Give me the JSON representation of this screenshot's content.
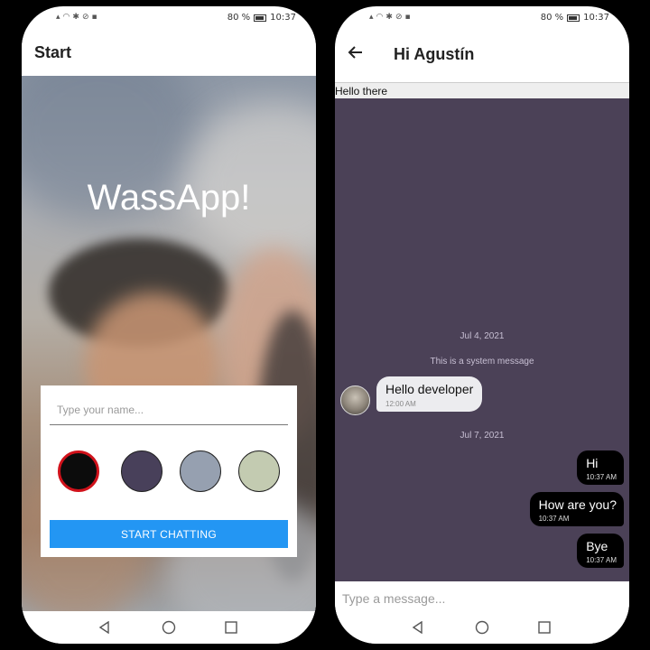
{
  "status": {
    "battery": "80 %",
    "time": "10:37"
  },
  "start_screen": {
    "appbar_title": "Start",
    "brand": "WassApp!",
    "name_placeholder": "Type your name...",
    "swatches": [
      {
        "color": "#0c0c0c",
        "selected": true
      },
      {
        "color": "#48405a",
        "selected": false
      },
      {
        "color": "#96a0b0",
        "selected": false
      },
      {
        "color": "#c3cbb1",
        "selected": false
      }
    ],
    "start_button": "START CHATTING"
  },
  "chat_screen": {
    "title": "Hi Agustín",
    "pinned_message": "Hello there",
    "date_1": "Jul 4, 2021",
    "system_message": "This is a system message",
    "incoming": {
      "text": "Hello developer",
      "time": "12:00 AM"
    },
    "date_2": "Jul 7, 2021",
    "outgoing": [
      {
        "text": "Hi",
        "time": "10:37 AM"
      },
      {
        "text": "How are you?",
        "time": "10:37 AM"
      },
      {
        "text": "Bye",
        "time": "10:37 AM"
      }
    ],
    "message_placeholder": "Type a message..."
  },
  "colors": {
    "accent": "#2396f3",
    "chat_background": "#4b4157",
    "selected_ring": "#d0121b"
  }
}
